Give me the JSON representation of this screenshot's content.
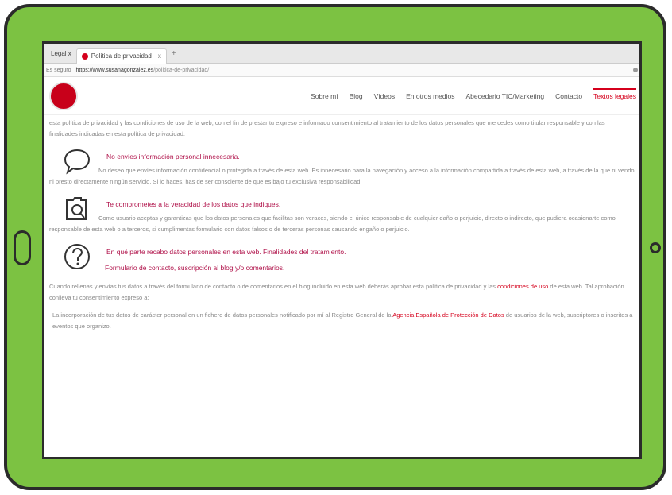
{
  "browser": {
    "tab_prev_label": "Legal x",
    "tab_active_title": "Política de privacidad",
    "tab_close": "x",
    "new_tab": "+",
    "url_secure": "Es seguro",
    "url_domain": "https://www.susanagonzalez.es",
    "url_path": "/politica-de-privacidad/"
  },
  "nav": {
    "items": [
      "Sobre mí",
      "Blog",
      "Vídeos",
      "En otros medios",
      "Abecedario TIC/Marketing",
      "Contacto",
      "Textos legales"
    ]
  },
  "content": {
    "intro": "esta política de privacidad y las condiciones de uso de la web, con el fin de prestar tu expreso e informado consentimiento al tratamiento de los datos personales que me cedes como titular responsable y con las finalidades indicadas en esta política de privacidad.",
    "section1": {
      "title": "No envíes información personal innecesaria.",
      "body": "No deseo que envíes información confidencial o protegida a través de esta web. Es innecesario para la navegación y acceso a la información compartida a través de esta web, a través de la que ni vendo ni presto directamente ningún servicio. Si lo haces, has de ser consciente de que es bajo tu exclusiva responsabilidad."
    },
    "section2": {
      "title": "Te comprometes a la veracidad de los datos que indiques.",
      "body": "Como usuario aceptas y garantizas que los datos personales que facilitas son veraces, siendo el único responsable de cualquier daño o perjuicio, directo o indirecto, que pudiera ocasionarte como responsable de esta web o a terceros, si cumplimentas formulario con datos falsos o de terceras personas causando engaño o perjuicio."
    },
    "section3": {
      "title": "En qué parte recabo datos personales en esta web. Finalidades del tratamiento.",
      "subtitle": "Formulario de contacto, suscripción al blog y/o comentarios."
    },
    "closing_before_link": "Cuando rellenas y envías tus datos a través del formulario de contacto o de comentarios en el blog incluido en esta web deberás aprobar esta política de privacidad y las",
    "closing_link": "condiciones de uso",
    "closing_after_link": "de esta web. Tal aprobación conlleva tu consentimiento expreso a:",
    "list_item_1_before": "La incorporación de tus datos de carácter personal en un fichero de datos personales notificado por mí al Registro General de la",
    "list_item_1_link": "Agencia Española de Protección de Datos",
    "list_item_1_after": "de usuarios de la web, suscriptores o inscritos a eventos que organizo."
  },
  "colors": {
    "frame": "#7cc242",
    "accent": "#d5001c",
    "heading": "#b0124a"
  }
}
